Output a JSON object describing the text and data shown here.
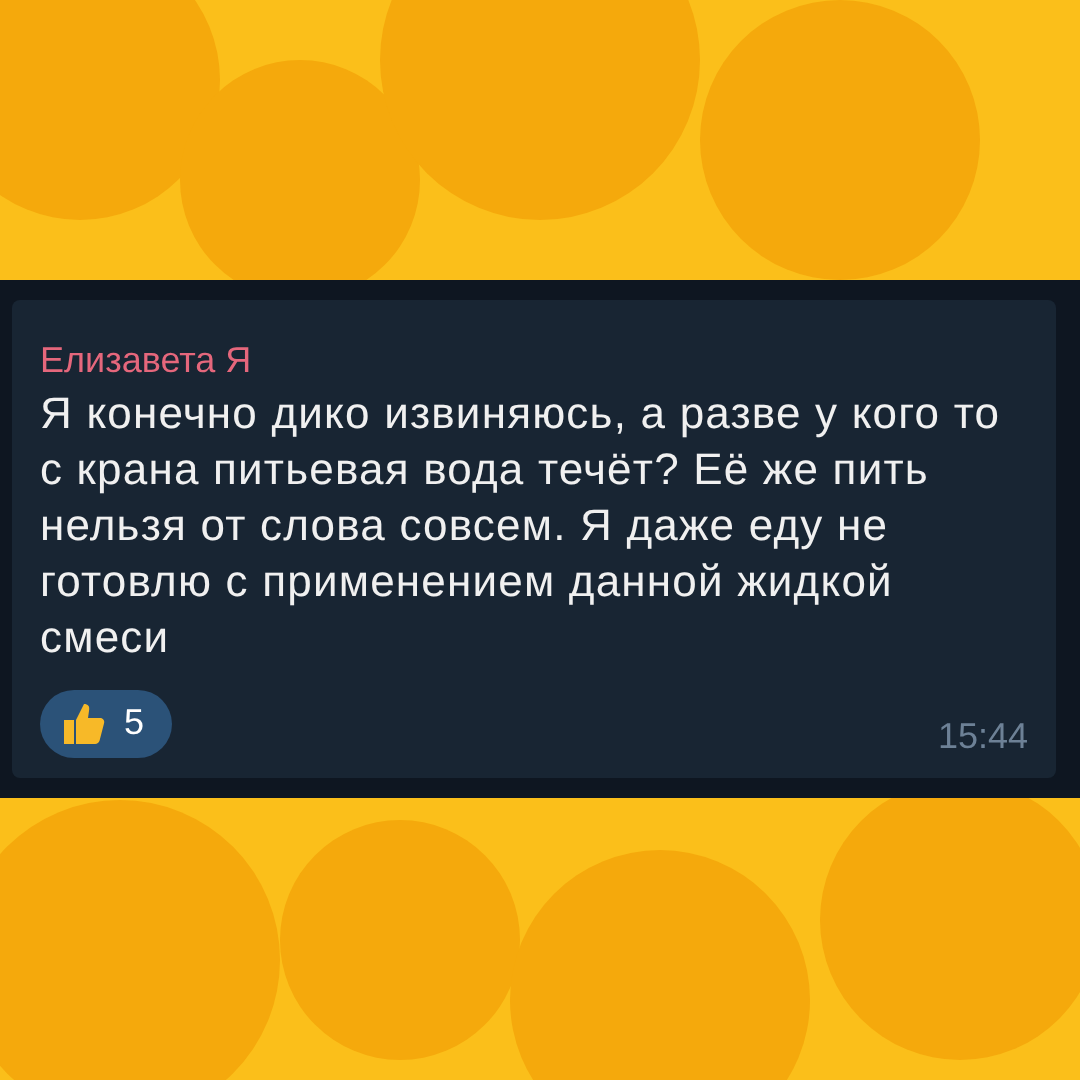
{
  "message": {
    "author": "Елизавета Я",
    "text": "Я конечно дико извиняюсь, а разве у кого то с крана питьевая вода течёт? Её же пить нельзя от слова совсем. Я даже еду не готовлю с применением данной жидкой смеси",
    "reactions": [
      {
        "count": "5"
      }
    ],
    "time": "15:44"
  }
}
